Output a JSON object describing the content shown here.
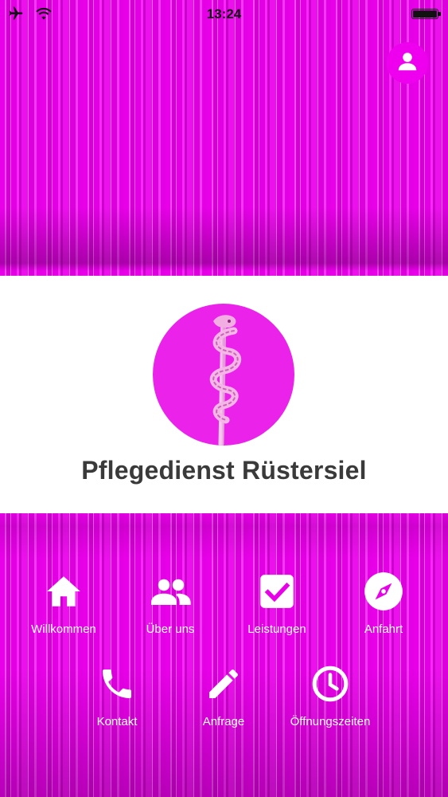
{
  "status_bar": {
    "time": "13:24",
    "icons": [
      "airplane-icon",
      "wifi-icon",
      "battery-icon"
    ]
  },
  "header": {
    "profile_icon": "user-icon"
  },
  "brand": {
    "name": "Pflegedienst Rüstersiel",
    "logo_icon": "rod-of-asclepius-icon"
  },
  "nav": {
    "row1": [
      {
        "label": "Willkommen",
        "icon": "home-icon"
      },
      {
        "label": "Über uns",
        "icon": "group-icon"
      },
      {
        "label": "Leistungen",
        "icon": "checkbox-icon"
      },
      {
        "label": "Anfahrt",
        "icon": "compass-icon"
      }
    ],
    "row2": [
      {
        "label": "Kontakt",
        "icon": "phone-icon"
      },
      {
        "label": "Anfrage",
        "icon": "pencil-icon"
      },
      {
        "label": "Öffnungszeiten",
        "icon": "clock-icon"
      }
    ]
  },
  "colors": {
    "accent": "#e800e8",
    "band": "#ffffff",
    "title": "#3a3a3a"
  }
}
